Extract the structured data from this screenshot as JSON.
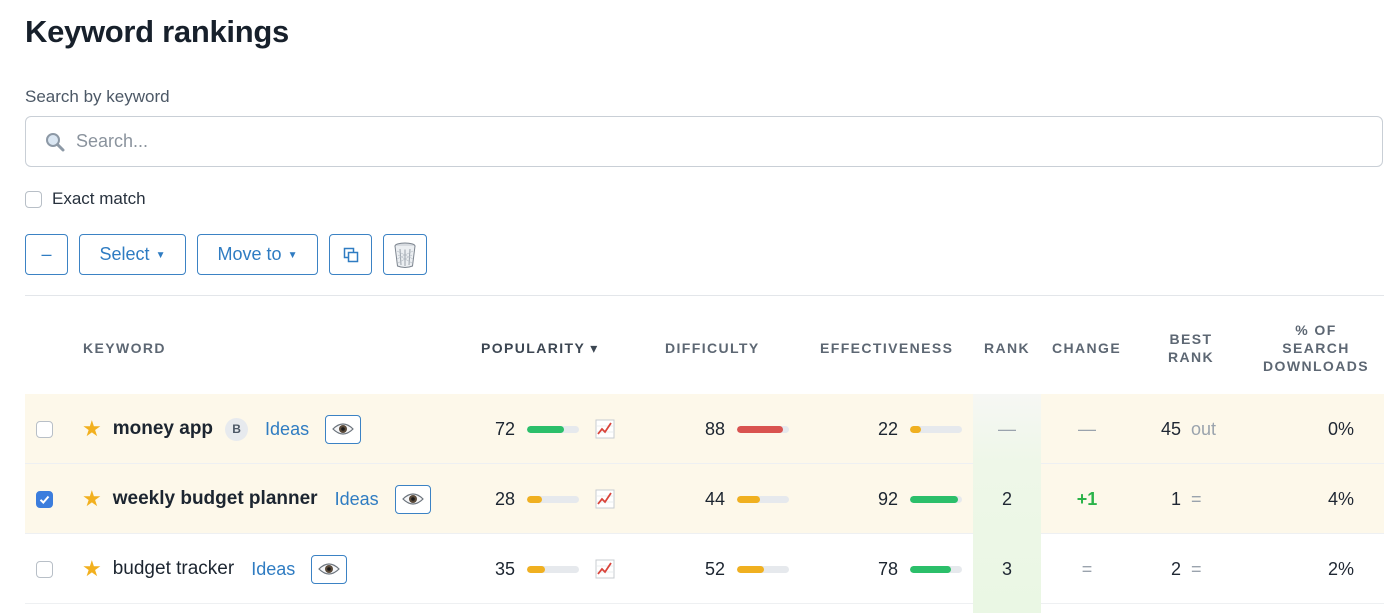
{
  "page_title": "Keyword rankings",
  "search": {
    "label": "Search by keyword",
    "placeholder": "Search...",
    "value": ""
  },
  "exact_match": {
    "label": "Exact match",
    "checked": false
  },
  "toolbar": {
    "minus_label": "–",
    "select_label": "Select",
    "move_to_label": "Move to"
  },
  "columns": {
    "keyword": "KEYWORD",
    "popularity": "POPULARITY ▾",
    "difficulty": "DIFFICULTY",
    "effectiveness": "EFFECTIVENESS",
    "rank": "RANK",
    "change": "CHANGE",
    "best_rank_1": "BEST",
    "best_rank_2": "RANK",
    "downloads_1": "% OF",
    "downloads_2": "SEARCH",
    "downloads_3": "DOWNLOADS"
  },
  "colors": {
    "accent": "#2f7cc2",
    "green": "#2bbf6a",
    "red": "#d9534f",
    "orange": "#f0b020",
    "star": "#f2b01e"
  },
  "rows": [
    {
      "keyword": "money app",
      "bold": true,
      "checked": false,
      "highlight": true,
      "badge": "B",
      "ideas": "Ideas",
      "popularity": "72",
      "popularity_fraction": 0.72,
      "popularity_color": "#2bbf6a",
      "difficulty": "88",
      "difficulty_fraction": 0.88,
      "difficulty_color": "#d9534f",
      "effectiveness": "22",
      "effectiveness_fraction": 0.22,
      "effectiveness_color": "#f0b020",
      "rank": "—",
      "change": "—",
      "best_rank": "45",
      "best_rank_suffix": "out",
      "downloads": "0%"
    },
    {
      "keyword": "weekly budget planner",
      "bold": true,
      "checked": true,
      "highlight": true,
      "badge": "",
      "ideas": "Ideas",
      "popularity": "28",
      "popularity_fraction": 0.28,
      "popularity_color": "#f0b020",
      "difficulty": "44",
      "difficulty_fraction": 0.44,
      "difficulty_color": "#f0b020",
      "effectiveness": "92",
      "effectiveness_fraction": 0.92,
      "effectiveness_color": "#2bbf6a",
      "rank": "2",
      "change": "+1",
      "best_rank": "1",
      "best_rank_suffix": "=",
      "downloads": "4%"
    },
    {
      "keyword": "budget tracker",
      "bold": false,
      "checked": false,
      "highlight": false,
      "badge": "",
      "ideas": "Ideas",
      "popularity": "35",
      "popularity_fraction": 0.35,
      "popularity_color": "#f0b020",
      "difficulty": "52",
      "difficulty_fraction": 0.52,
      "difficulty_color": "#f0b020",
      "effectiveness": "78",
      "effectiveness_fraction": 0.78,
      "effectiveness_color": "#2bbf6a",
      "rank": "3",
      "change": "=",
      "best_rank": "2",
      "best_rank_suffix": "=",
      "downloads": "2%"
    }
  ]
}
